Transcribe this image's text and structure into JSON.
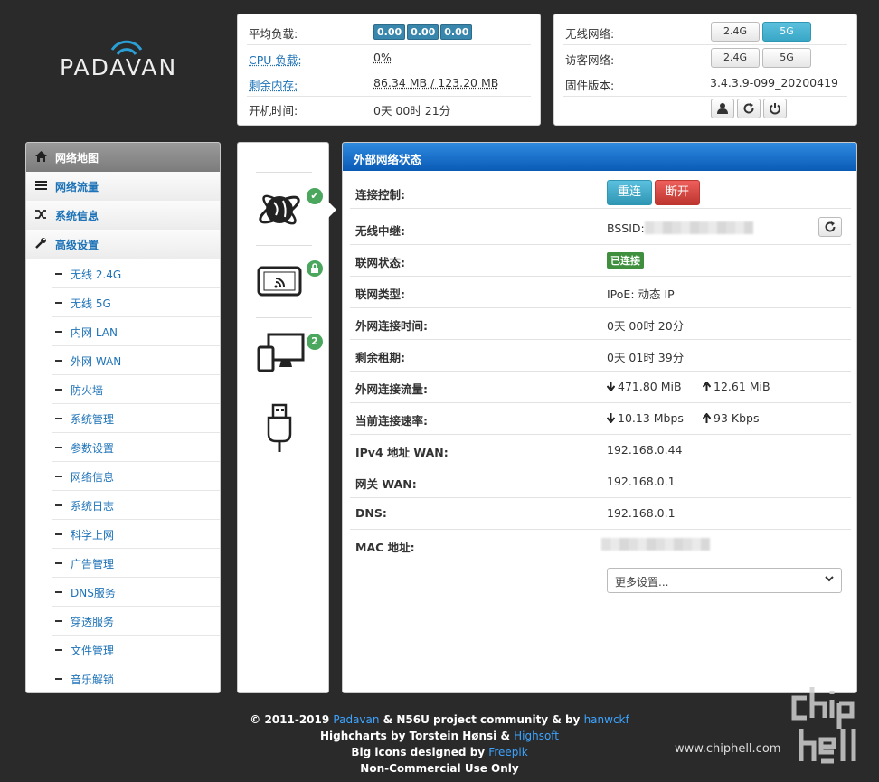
{
  "logo": {
    "brand": "PADAVAN"
  },
  "status": {
    "load_label": "平均负载:",
    "load_values": [
      "0.00",
      "0.00",
      "0.00"
    ],
    "cpu_label": "CPU 负载:",
    "cpu_value": "0%",
    "mem_label": "剩余内存:",
    "mem_value": "86.34 MB / 123.20 MB",
    "uptime_label": "开机时间:",
    "uptime_value": "0天 00时 21分"
  },
  "firmware": {
    "wireless_label": "无线网络:",
    "wireless_btn_24": "2.4G",
    "wireless_btn_5": "5G",
    "guest_label": "访客网络:",
    "guest_btn_24": "2.4G",
    "guest_btn_5": "5G",
    "fw_label": "固件版本:",
    "fw_value": "3.4.3.9-099_20200419"
  },
  "sidebar": {
    "items": [
      {
        "label": "网络地图",
        "icon": "home-icon",
        "active": true
      },
      {
        "label": "网络流量",
        "icon": "list-icon",
        "active": false
      },
      {
        "label": "系统信息",
        "icon": "shuffle-icon",
        "active": false
      },
      {
        "label": "高级设置",
        "icon": "wrench-icon",
        "active": false
      }
    ],
    "sub_items": [
      "无线 2.4G",
      "无线 5G",
      "内网 LAN",
      "外网 WAN",
      "防火墙",
      "系统管理",
      "参数设置",
      "网络信息",
      "系统日志",
      "科学上网",
      "广告管理",
      "DNS服务",
      "穿透服务",
      "文件管理",
      "音乐解锁"
    ]
  },
  "icons": {
    "internet_badge": "✔",
    "wireless_badge": "🔒",
    "clients_badge": "2"
  },
  "main": {
    "title": "外部网络状态",
    "rows": {
      "control_label": "连接控制:",
      "reconnect_btn": "重连",
      "disconnect_btn": "断开",
      "repeater_label": "无线中继:",
      "repeater_value": "BSSID:",
      "netstate_label": "联网状态:",
      "netstate_value": "已连接",
      "nettype_label": "联网类型:",
      "nettype_value": "IPoE: 动态 IP",
      "conntime_label": "外网连接时间:",
      "conntime_value": "0天 00时 20分",
      "lease_label": "剩余租期:",
      "lease_value": "0天 01时 39分",
      "traffic_label": "外网连接流量:",
      "traffic_down": "471.80 MiB",
      "traffic_up": "12.61 MiB",
      "speed_label": "当前连接速率:",
      "speed_down": "10.13 Mbps",
      "speed_up": "93 Kbps",
      "ipv4_label": "IPv4 地址 WAN:",
      "ipv4_value": "192.168.0.44",
      "gw_label": "网关 WAN:",
      "gw_value": "192.168.0.1",
      "dns_label": "DNS:",
      "dns_value": "192.168.0.1",
      "mac_label": "MAC 地址:"
    },
    "more_select": "更多设置..."
  },
  "footer": {
    "line1_prefix": "© 2011-2019 ",
    "line1_link1": "Padavan",
    "line1_mid": " & N56U project community & by ",
    "line1_link2": "hanwckf",
    "line2_prefix": "Highcharts by Torstein Hønsi & ",
    "line2_link": "Highsoft",
    "line3_prefix": "Big icons designed by ",
    "line3_link": "Freepik",
    "line4": "Non-Commercial Use Only"
  },
  "watermark": {
    "url": "www.chiphell.com"
  },
  "colors": {
    "accent": "#1e73b8",
    "header_blue": "#0a5bb5",
    "info": "#5bc0de",
    "danger": "#d9534f",
    "success": "#3f8f3f",
    "background": "#2a2a2a"
  }
}
